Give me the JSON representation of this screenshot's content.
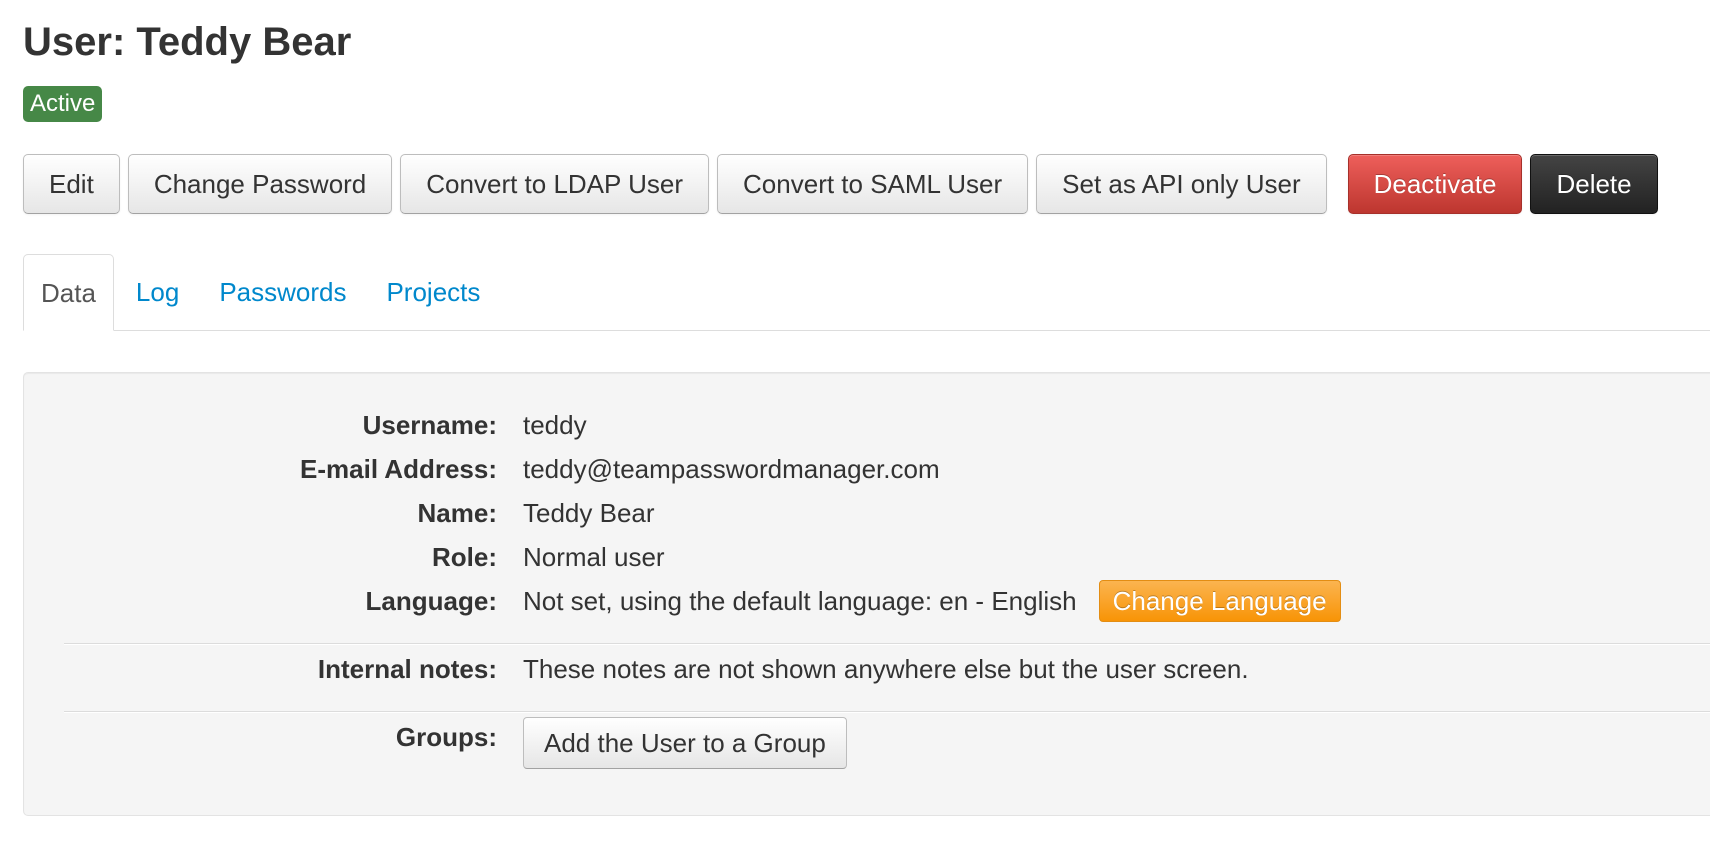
{
  "header": {
    "title": "User: Teddy Bear",
    "status": "Active",
    "status_color": "#468847"
  },
  "toolbar": {
    "edit": "Edit",
    "change_password": "Change Password",
    "convert_ldap": "Convert to LDAP User",
    "convert_saml": "Convert to SAML User",
    "set_api_only": "Set as API only User",
    "deactivate": "Deactivate",
    "delete": "Delete"
  },
  "tabs": [
    {
      "label": "Data",
      "active": true
    },
    {
      "label": "Log",
      "active": false
    },
    {
      "label": "Passwords",
      "active": false
    },
    {
      "label": "Projects",
      "active": false
    }
  ],
  "details": {
    "username_label": "Username:",
    "username": "teddy",
    "email_label": "E-mail Address:",
    "email": "teddy@teampasswordmanager.com",
    "name_label": "Name:",
    "name": "Teddy Bear",
    "role_label": "Role:",
    "role": "Normal user",
    "language_label": "Language:",
    "language": "Not set, using the default language: en - English",
    "change_language": "Change Language",
    "notes_label": "Internal notes:",
    "notes": "These notes are not shown anywhere else but the user screen.",
    "groups_label": "Groups:",
    "add_to_group": "Add the User to a Group"
  },
  "colors": {
    "link": "#0088cc",
    "danger": "#da4f49",
    "inverse": "#363636",
    "warning": "#f89406",
    "panel_bg": "#f5f5f5"
  }
}
